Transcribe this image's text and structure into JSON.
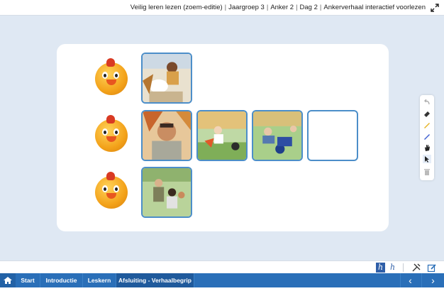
{
  "header": {
    "breadcrumb": [
      "Veilig leren lezen (zoem-editie)",
      "Jaargroep 3",
      "Anker 2",
      "Dag 2",
      "Ankerverhaal interactief voorlezen"
    ],
    "separator": "|",
    "expand_icon": "expand-icon"
  },
  "board": {
    "rows": [
      {
        "mascot": "rooster-mascot",
        "cards": [
          "story-image-1"
        ]
      },
      {
        "mascot": "rooster-mascot",
        "cards": [
          "story-image-2",
          "story-image-3",
          "story-image-4",
          "empty-slot"
        ]
      },
      {
        "mascot": "rooster-mascot",
        "cards": [
          "story-image-5"
        ]
      }
    ]
  },
  "tools": [
    "undo-icon",
    "eraser-icon",
    "pencil-yellow-icon",
    "pencil-blue-icon",
    "hand-icon",
    "pointer-icon",
    "trash-icon"
  ],
  "bottombar": {
    "font_toggle_active": "h",
    "font_toggle_inactive": "h"
  },
  "nav": {
    "tabs": [
      "Start",
      "Introductie",
      "Leskern",
      "Afsluiting - Verhaalbegrip"
    ],
    "active_tab": "Afsluiting - Verhaalbegrip",
    "prev_label": "‹",
    "next_label": "›"
  },
  "colors": {
    "accent": "#2a6fb8",
    "stage_bg": "#dfe8f3",
    "card_border": "#4c8ec9"
  }
}
